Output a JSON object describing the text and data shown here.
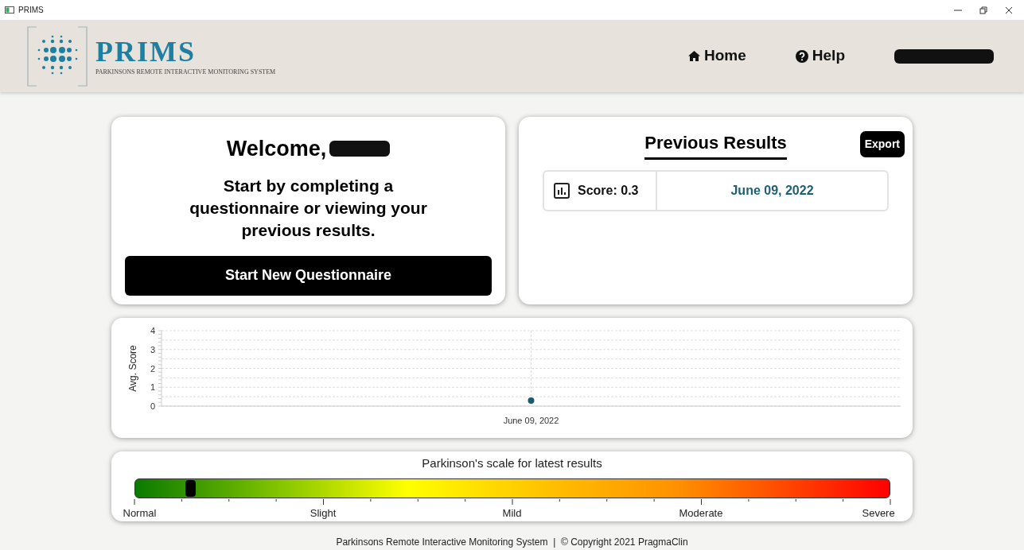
{
  "window": {
    "title": "PRIMS"
  },
  "header": {
    "logo_text": "PRIMS",
    "logo_tagline": "PARKINSONS REMOTE INTERACTIVE MONITORING SYSTEM",
    "nav": [
      {
        "label": "Home",
        "kind": "home"
      },
      {
        "label": "Help",
        "kind": "help"
      }
    ],
    "user_redacted": true
  },
  "welcome": {
    "greeting": "Welcome,",
    "name_redacted": true,
    "message": "Start by completing a questionnaire or viewing your previous results.",
    "button": "Start New Questionnaire"
  },
  "previous_results": {
    "title": "Previous Results",
    "export": "Export",
    "results": [
      {
        "score": "Score: 0.3",
        "date": "June 09, 2022"
      }
    ]
  },
  "chart": {
    "chart_data": {
      "type": "scatter",
      "ylabel": "Avg. Score",
      "categories": [
        "June 09, 2022"
      ],
      "series": [
        {
          "color": "#1b5a6e",
          "values": [
            0.3
          ]
        }
      ],
      "ylim": [
        0,
        4
      ],
      "yticks": [
        0,
        1,
        2,
        3,
        4
      ],
      "grid": true
    }
  },
  "scale": {
    "title": "Parkinson's scale for latest results",
    "level": 0.073,
    "labels": [
      "Normal",
      "Slight",
      "Mild",
      "Moderate",
      "Severe"
    ]
  },
  "footer": "Parkinsons Remote Interactive Monitoring System  |  © Copyright 2021 PragmaClin"
}
